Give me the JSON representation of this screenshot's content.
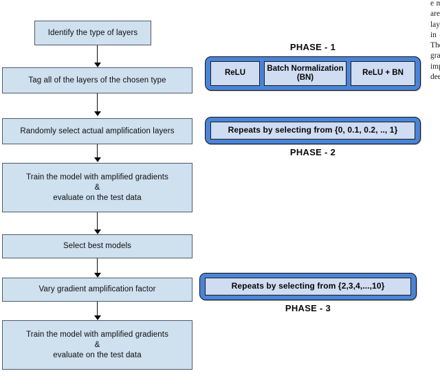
{
  "figure": {
    "type": "flowchart-diagram",
    "flow_steps": [
      {
        "id": "identify-layer-type",
        "label": "Identify the type of layers"
      },
      {
        "id": "tag-layers",
        "label": "Tag all of the layers of the chosen type"
      },
      {
        "id": "random-select-layers",
        "label": "Randomly select actual amplification layers"
      },
      {
        "id": "train-evaluate-1",
        "label": "Train the model with amplified gradients\n&\nevaluate on the test data"
      },
      {
        "id": "select-best-models",
        "label": "Select best models"
      },
      {
        "id": "vary-amplification-factor",
        "label": "Vary gradient amplification factor"
      },
      {
        "id": "train-evaluate-2",
        "label": "Train the model with amplified gradients\n&\nevaluate on the test data"
      }
    ],
    "phases": [
      {
        "id": "phase-1",
        "label": "PHASE - 1",
        "label_position": "above",
        "options": [
          {
            "id": "relu",
            "label": "ReLU"
          },
          {
            "id": "batch-normalization",
            "label": "Batch Normalization\n(BN)"
          },
          {
            "id": "relu-plus-bn",
            "label": "ReLU + BN"
          }
        ]
      },
      {
        "id": "phase-2",
        "label": "PHASE - 2",
        "label_position": "below",
        "options": [
          {
            "id": "repeats-ratio",
            "label": "Repeats by selecting from {0, 0.1, 0.2, .., 1}"
          }
        ]
      },
      {
        "id": "phase-3",
        "label": "PHASE - 3",
        "label_position": "below",
        "options": [
          {
            "id": "repeats-factor",
            "label": "Repeats by selecting from {2,3,4,...,10}"
          }
        ]
      }
    ],
    "colors": {
      "flow_box_fill": "#cfe0ef",
      "flow_box_border": "#4e5a66",
      "phase_panel_fill": "#4a84d8",
      "phase_inner_fill": "#cfdcf2",
      "phase_border": "#111111",
      "arrow": "#0a0a0a"
    }
  },
  "edge_column": {
    "text": "e model. The gradient amplification factors are selected from the set of values and the layers of the network are chosen randomly in each epoch during the training process. The amplification is performed on the gradients of the selected layers and this improves the overall performance of the deep neural network architectures."
  }
}
